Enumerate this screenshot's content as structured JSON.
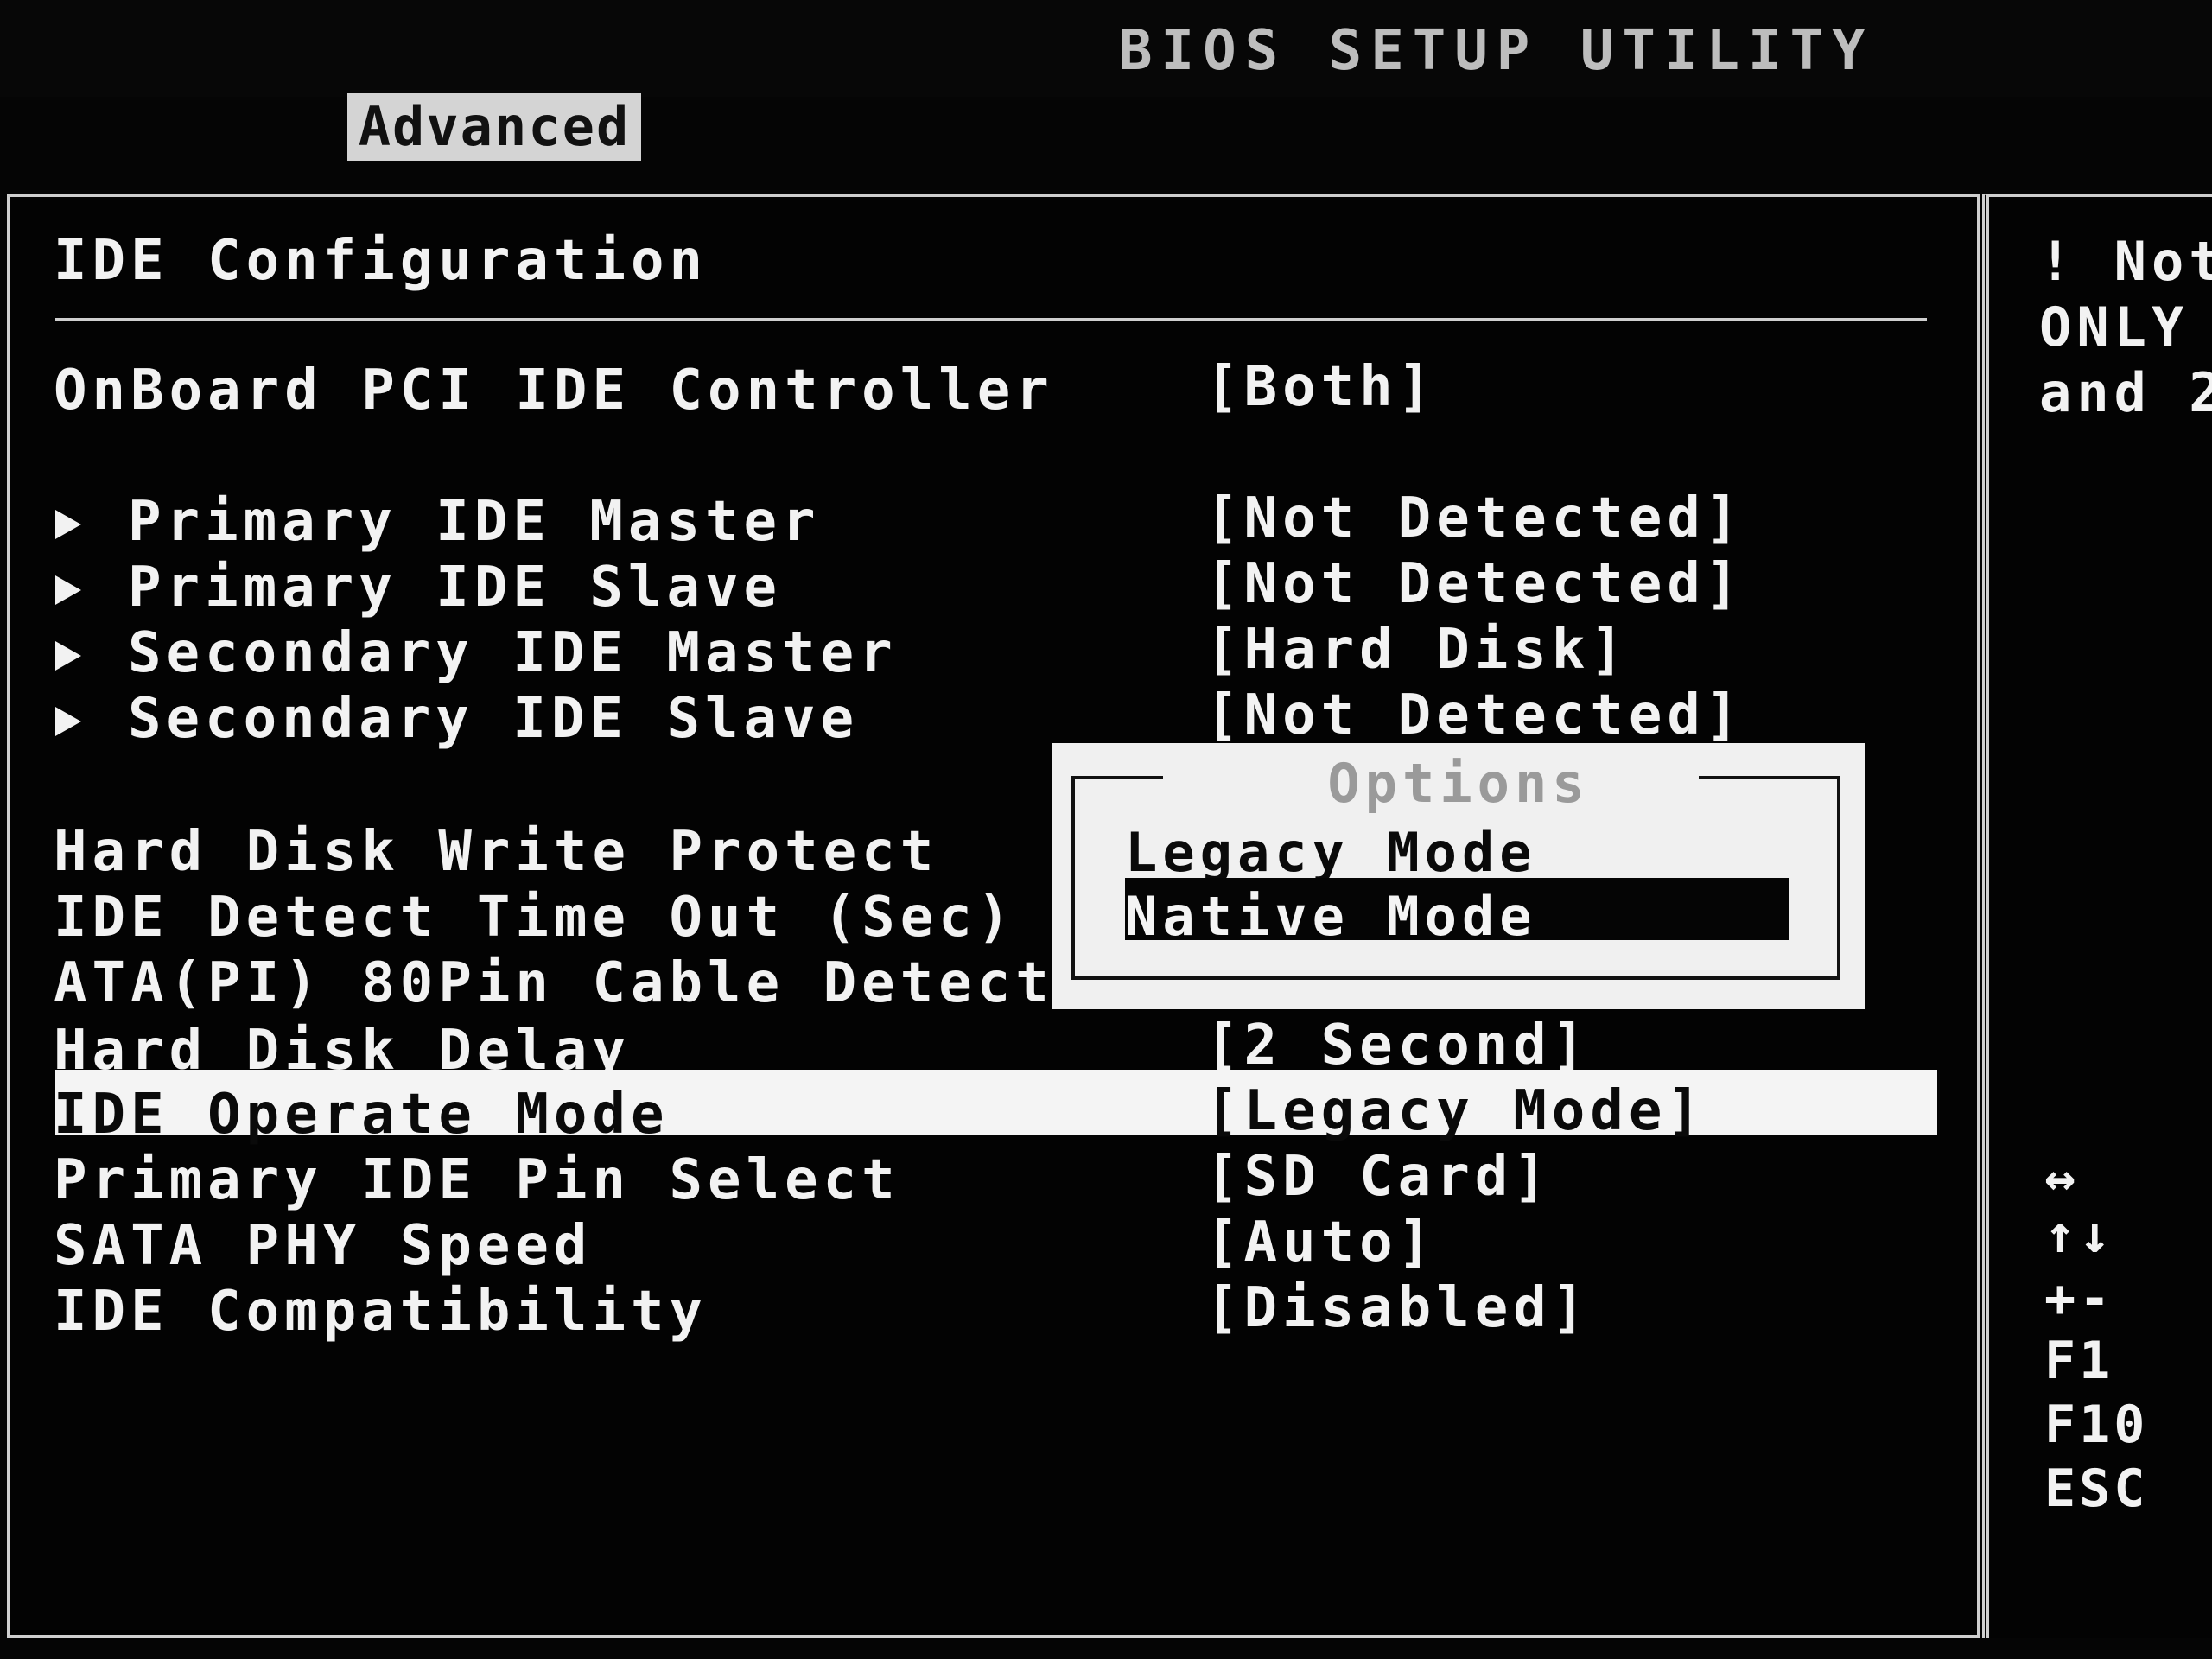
{
  "app": {
    "title": "BIOS SETUP UTILITY"
  },
  "tabs": [
    {
      "label": "Advanced",
      "active": true
    }
  ],
  "main": {
    "heading": "IDE Configuration",
    "controller": {
      "label": "OnBoard PCI IDE Controller",
      "value": "[Both]"
    },
    "submenus": [
      {
        "label": "Primary IDE Master",
        "value": "[Not Detected]"
      },
      {
        "label": "Primary IDE Slave",
        "value": "[Not Detected]"
      },
      {
        "label": "Secondary IDE Master",
        "value": "[Hard Disk]"
      },
      {
        "label": "Secondary IDE Slave",
        "value": "[Not Detected]"
      }
    ],
    "settings": [
      {
        "label": "Hard Disk Write Protect",
        "value": ""
      },
      {
        "label": "IDE Detect Time Out (Sec)",
        "value": ""
      },
      {
        "label": "ATA(PI) 80Pin Cable Detecti",
        "value": ""
      },
      {
        "label": "Hard Disk Delay",
        "value": "[2 Second]"
      },
      {
        "label": "IDE Operate Mode",
        "value": "[Legacy Mode]",
        "selected": true
      },
      {
        "label": "Primary IDE Pin Select",
        "value": "[SD Card]"
      },
      {
        "label": "SATA PHY Speed",
        "value": "[Auto]"
      },
      {
        "label": "IDE Compatibility",
        "value": "[Disabled]"
      }
    ]
  },
  "popup": {
    "title": "Options",
    "options": [
      {
        "label": "Legacy Mode",
        "selected": false
      },
      {
        "label": "Native Mode",
        "selected": true
      }
    ]
  },
  "help": {
    "lines": [
      "! Not",
      "ONLY",
      "and 2"
    ],
    "keys": [
      "↔",
      "↑↓",
      "+-",
      "F1",
      "F10",
      "ESC"
    ]
  }
}
